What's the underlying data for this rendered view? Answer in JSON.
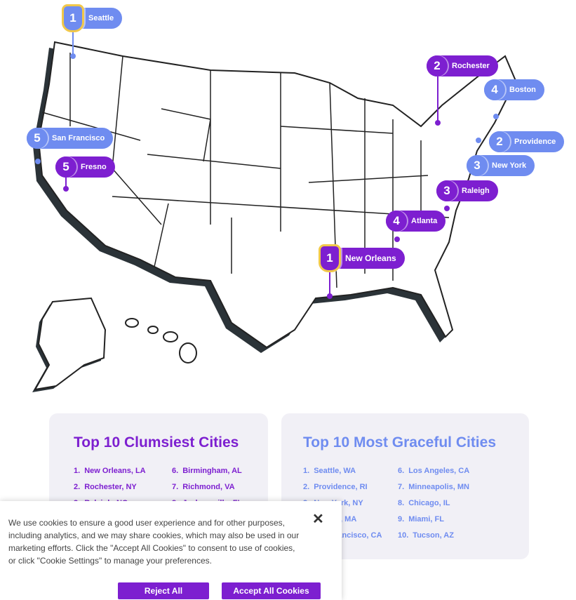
{
  "map": {
    "pins": [
      {
        "rank": "1",
        "city": "Seattle",
        "list": "graceful"
      },
      {
        "rank": "2",
        "city": "Rochester",
        "list": "clumsiest"
      },
      {
        "rank": "4",
        "city": "Boston",
        "list": "graceful"
      },
      {
        "rank": "2",
        "city": "Providence",
        "list": "graceful"
      },
      {
        "rank": "3",
        "city": "New York",
        "list": "graceful"
      },
      {
        "rank": "5",
        "city": "San Francisco",
        "list": "graceful"
      },
      {
        "rank": "5",
        "city": "Fresno",
        "list": "clumsiest"
      },
      {
        "rank": "3",
        "city": "Raleigh",
        "list": "clumsiest"
      },
      {
        "rank": "4",
        "city": "Atlanta",
        "list": "clumsiest"
      },
      {
        "rank": "1",
        "city": "New Orleans",
        "list": "clumsiest"
      }
    ],
    "colors": {
      "graceful": "#6f8cf0",
      "clumsiest": "#7d1fd0",
      "top_badge": "#f1c84a",
      "land_shadow": "#2b3338"
    }
  },
  "clumsiest": {
    "title": "Top 10 Clumsiest Cities",
    "items": [
      {
        "n": "1.",
        "city": "New Orleans, LA"
      },
      {
        "n": "2.",
        "city": "Rochester, NY"
      },
      {
        "n": "3.",
        "city": "Raleigh, NC"
      },
      {
        "n": "6.",
        "city": "Birmingham, AL"
      },
      {
        "n": "7.",
        "city": "Richmond, VA"
      },
      {
        "n": "8.",
        "city": "Jacksonville, FL"
      }
    ]
  },
  "graceful": {
    "title": "Top 10 Most Graceful Cities",
    "items": [
      {
        "n": "1.",
        "city": "Seattle, WA"
      },
      {
        "n": "2.",
        "city": "Providence, RI"
      },
      {
        "n": "3.",
        "city": "New York, NY"
      },
      {
        "n": "4.",
        "city": "Boston, MA"
      },
      {
        "n": "5.",
        "city": "San Francisco, CA"
      },
      {
        "n": "6.",
        "city": "Los Angeles, CA"
      },
      {
        "n": "7.",
        "city": "Minneapolis, MN"
      },
      {
        "n": "8.",
        "city": "Chicago, IL"
      },
      {
        "n": "9.",
        "city": "Miami, FL"
      },
      {
        "n": "10.",
        "city": "Tucson, AZ"
      }
    ]
  },
  "cookie": {
    "text": "We use cookies to ensure a good user experience and for other purposes, including analytics, and we may share cookies, which may also be used in our marketing efforts. Click the \"Accept All Cookies\" to consent to use of cookies, or click \"Cookie Settings\" to manage your preferences.",
    "close": "✕",
    "reject": "Reject All",
    "accept": "Accept All Cookies"
  }
}
